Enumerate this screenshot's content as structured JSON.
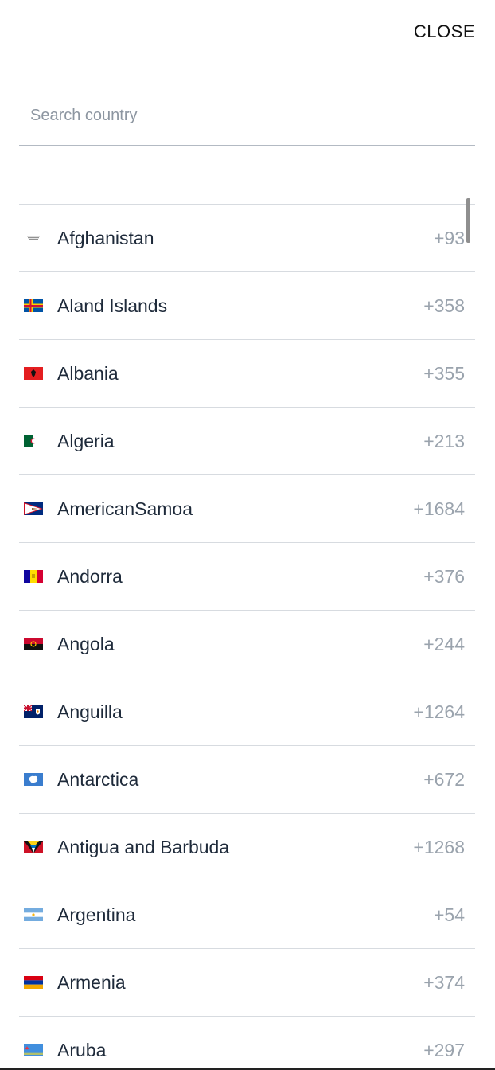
{
  "header": {
    "close_label": "CLOSE"
  },
  "search": {
    "placeholder": "Search country",
    "value": ""
  },
  "countries": [
    {
      "name": "Afghanistan",
      "code": "+93",
      "flag": "afghanistan-flag-icon"
    },
    {
      "name": "Aland Islands",
      "code": "+358",
      "flag": "aland-islands-flag-icon"
    },
    {
      "name": "Albania",
      "code": "+355",
      "flag": "albania-flag-icon"
    },
    {
      "name": "Algeria",
      "code": "+213",
      "flag": "algeria-flag-icon"
    },
    {
      "name": "AmericanSamoa",
      "code": "+1684",
      "flag": "american-samoa-flag-icon"
    },
    {
      "name": "Andorra",
      "code": "+376",
      "flag": "andorra-flag-icon"
    },
    {
      "name": "Angola",
      "code": "+244",
      "flag": "angola-flag-icon"
    },
    {
      "name": "Anguilla",
      "code": "+1264",
      "flag": "anguilla-flag-icon"
    },
    {
      "name": "Antarctica",
      "code": "+672",
      "flag": "antarctica-flag-icon"
    },
    {
      "name": "Antigua and Barbuda",
      "code": "+1268",
      "flag": "antigua-barbuda-flag-icon"
    },
    {
      "name": "Argentina",
      "code": "+54",
      "flag": "argentina-flag-icon"
    },
    {
      "name": "Armenia",
      "code": "+374",
      "flag": "armenia-flag-icon"
    },
    {
      "name": "Aruba",
      "code": "+297",
      "flag": "aruba-flag-icon"
    }
  ]
}
